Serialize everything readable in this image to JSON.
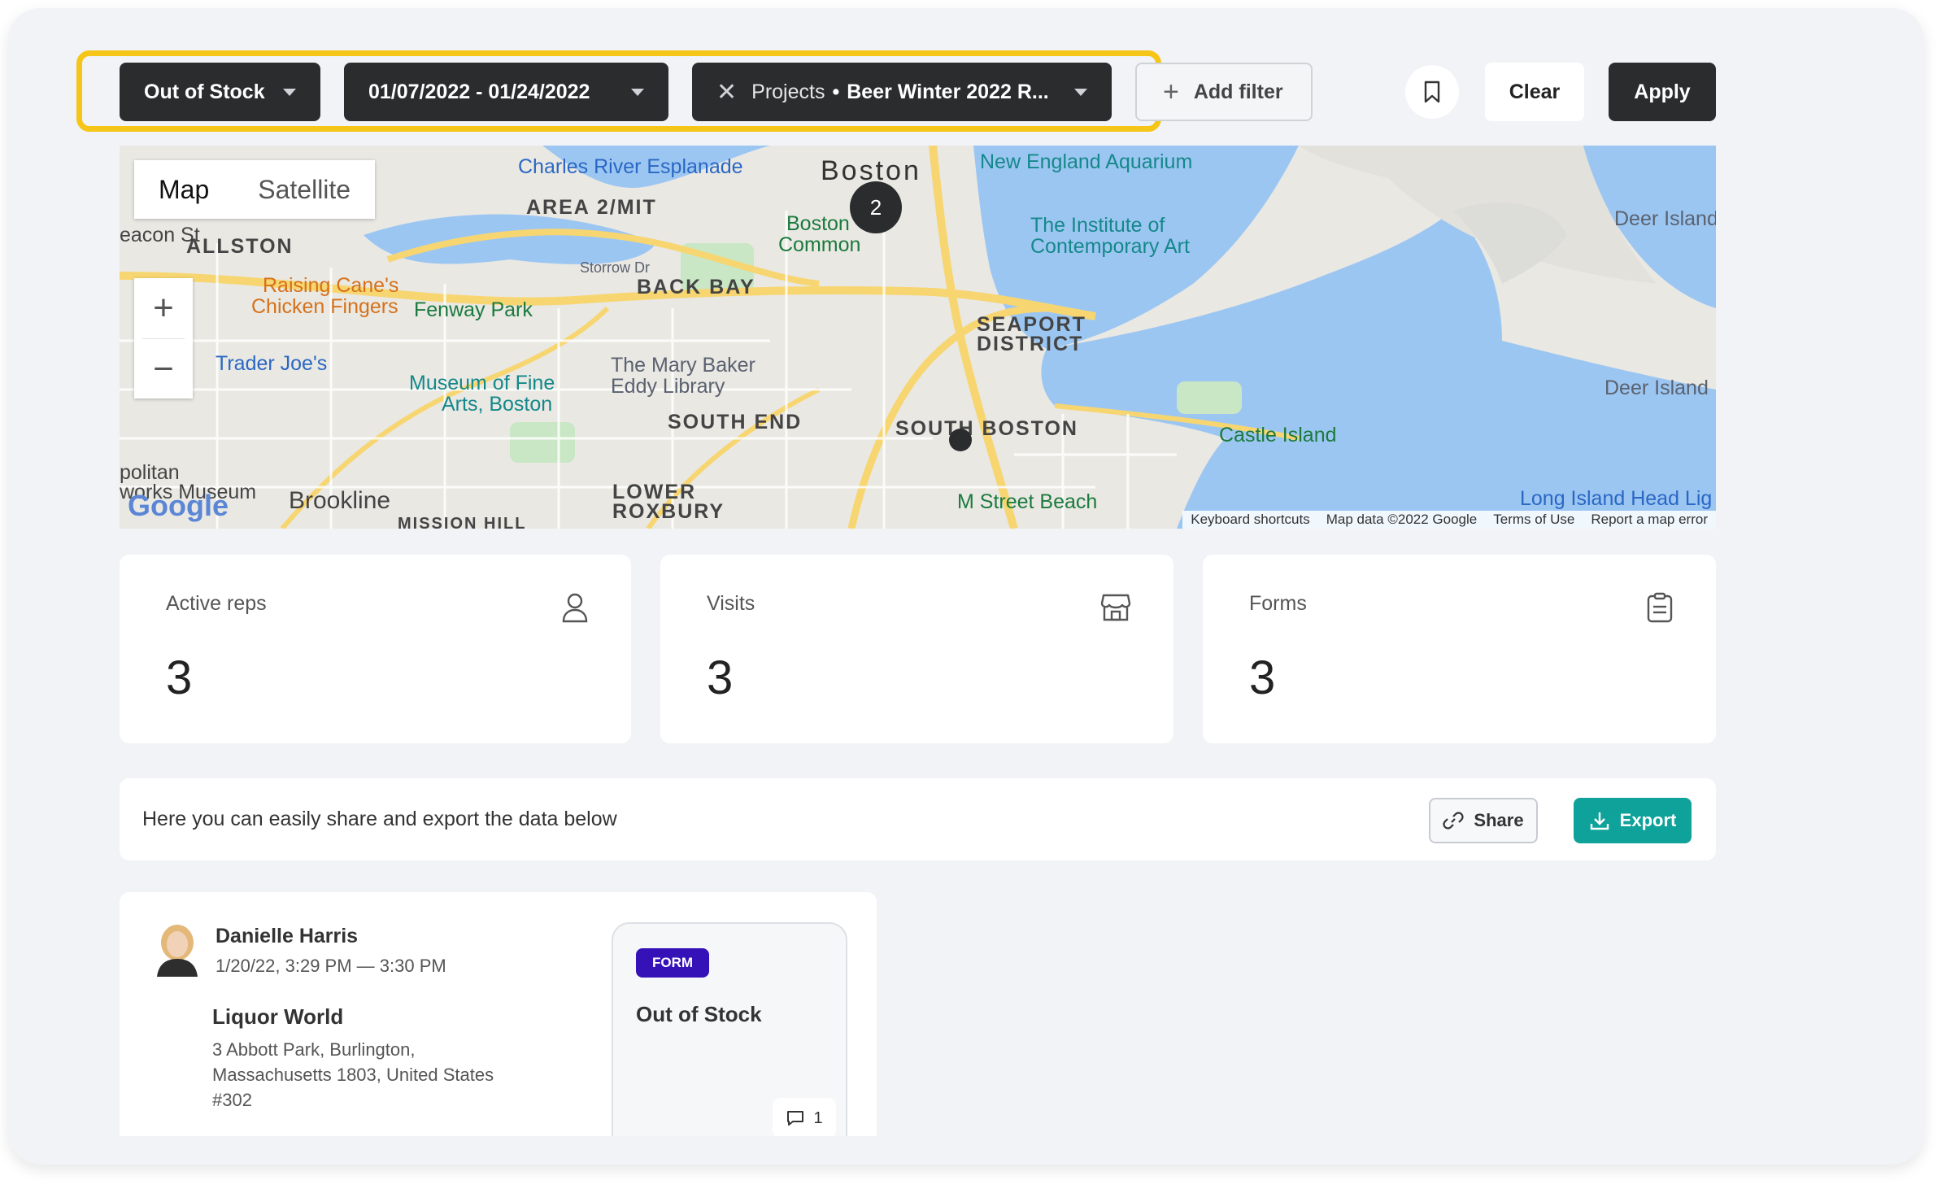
{
  "filters": {
    "chip1": "Out of Stock",
    "chip2": "01/07/2022 - 01/24/2022",
    "chip3_prefix": "Projects",
    "chip3_value": "Beer Winter 2022 R...",
    "add_filter": "Add filter"
  },
  "actions": {
    "clear": "Clear",
    "apply": "Apply"
  },
  "map": {
    "toggle_map": "Map",
    "toggle_satellite": "Satellite",
    "zoom_in": "+",
    "zoom_out": "−",
    "cluster_count": "2",
    "labels": {
      "charles": "Charles River Esplanade",
      "area2": "AREA 2/MIT",
      "boston": "Boston",
      "aquarium": "New England Aquarium",
      "allston": "ALLSTON",
      "beacon": "eacon St",
      "boston_common1": "Boston",
      "boston_common2": "Common",
      "ica1": "The Institute of",
      "ica2": "Contemporary Art",
      "deer1": "Deer Island",
      "raising1": "Raising Cane's",
      "raising2": "Chicken Fingers",
      "fenway": "Fenway Park",
      "storrow": "Storrow Dr",
      "backbay": "BACK BAY",
      "seaport1": "SEAPORT",
      "seaport2": "DISTRICT",
      "traderjoes": "Trader Joe's",
      "marybaker1": "The Mary Baker",
      "marybaker2": "Eddy Library",
      "mfa1": "Museum of Fine",
      "mfa2": "Arts, Boston",
      "southend": "SOUTH END",
      "southboston": "SOUTH BOSTON",
      "castle": "Castle Island",
      "deer2": "Deer Island",
      "politan": "politan",
      "works": "works Museum",
      "brookline": "Brookline",
      "lowerrox1": "LOWER",
      "lowerrox2": "ROXBURY",
      "mstreet": "M Street Beach",
      "longisland": "Long Island Head Lig",
      "mission": "MISSION HILL"
    },
    "google": "Google",
    "attribution": [
      "Keyboard shortcuts",
      "Map data ©2022 Google",
      "Terms of Use",
      "Report a map error"
    ]
  },
  "stats": [
    {
      "title": "Active reps",
      "value": "3",
      "icon": "person-icon"
    },
    {
      "title": "Visits",
      "value": "3",
      "icon": "store-icon"
    },
    {
      "title": "Forms",
      "value": "3",
      "icon": "clipboard-icon"
    }
  ],
  "share_bar": {
    "text": "Here you can easily share and export the data below",
    "share": "Share",
    "export": "Export"
  },
  "visit": {
    "rep_name": "Danielle Harris",
    "time": "1/20/22, 3:29 PM — 3:30 PM",
    "store": "Liquor World",
    "address_line1": "3 Abbott Park, Burlington,",
    "address_line2": "Massachusetts 1803, United States",
    "store_number": "#302",
    "badge": "FORM",
    "form_title": "Out of Stock",
    "comment_count": "1"
  },
  "colors": {
    "accent_teal": "#0fa29a",
    "dark_chip": "#2a2c2e",
    "highlight_yellow": "#f5c518",
    "form_badge": "#3512b8"
  }
}
